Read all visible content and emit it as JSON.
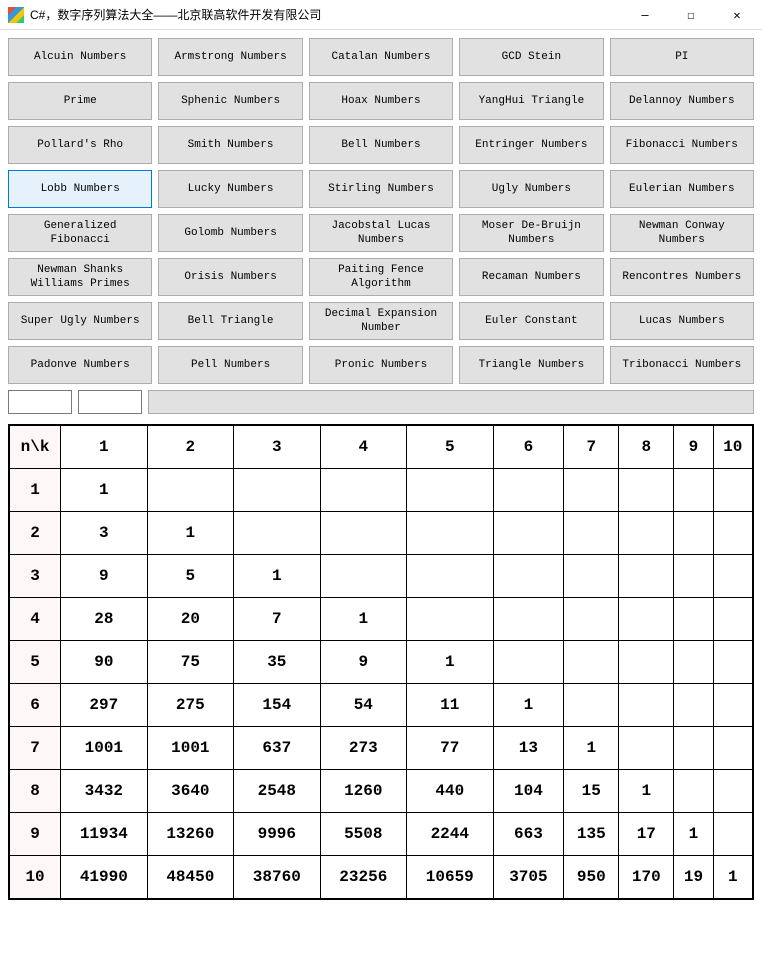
{
  "window": {
    "title": "C#，数字序列算法大全——北京联高软件开发有限公司",
    "min": "—",
    "max": "☐",
    "close": "✕"
  },
  "buttons": [
    [
      {
        "label": "Alcuin Numbers",
        "selected": false
      },
      {
        "label": "Armstrong Numbers",
        "selected": false
      },
      {
        "label": "Catalan Numbers",
        "selected": false
      },
      {
        "label": "GCD Stein",
        "selected": false
      },
      {
        "label": "PI",
        "selected": false
      }
    ],
    [
      {
        "label": "Prime",
        "selected": false
      },
      {
        "label": "Sphenic Numbers",
        "selected": false
      },
      {
        "label": "Hoax Numbers",
        "selected": false
      },
      {
        "label": "YangHui Triangle",
        "selected": false
      },
      {
        "label": "Delannoy Numbers",
        "selected": false
      }
    ],
    [
      {
        "label": "Pollard's Rho",
        "selected": false
      },
      {
        "label": "Smith Numbers",
        "selected": false
      },
      {
        "label": "Bell Numbers",
        "selected": false
      },
      {
        "label": "Entringer Numbers",
        "selected": false
      },
      {
        "label": "Fibonacci Numbers",
        "selected": false
      }
    ],
    [
      {
        "label": "Lobb Numbers",
        "selected": true
      },
      {
        "label": "Lucky Numbers",
        "selected": false
      },
      {
        "label": "Stirling Numbers",
        "selected": false
      },
      {
        "label": "Ugly Numbers",
        "selected": false
      },
      {
        "label": "Eulerian Numbers",
        "selected": false
      }
    ],
    [
      {
        "label": "Generalized Fibonacci",
        "selected": false
      },
      {
        "label": "Golomb Numbers",
        "selected": false
      },
      {
        "label": "Jacobstal Lucas Numbers",
        "selected": false
      },
      {
        "label": "Moser De-Bruijn Numbers",
        "selected": false
      },
      {
        "label": "Newman Conway Numbers",
        "selected": false
      }
    ],
    [
      {
        "label": "Newman Shanks Williams Primes",
        "selected": false
      },
      {
        "label": "Orisis Numbers",
        "selected": false
      },
      {
        "label": "Paiting Fence Algorithm",
        "selected": false
      },
      {
        "label": "Recaman Numbers",
        "selected": false
      },
      {
        "label": "Rencontres Numbers",
        "selected": false
      }
    ],
    [
      {
        "label": "Super Ugly Numbers",
        "selected": false
      },
      {
        "label": "Bell Triangle",
        "selected": false
      },
      {
        "label": "Decimal Expansion Number",
        "selected": false
      },
      {
        "label": "Euler Constant",
        "selected": false
      },
      {
        "label": "Lucas Numbers",
        "selected": false
      }
    ],
    [
      {
        "label": "Padonve Numbers",
        "selected": false
      },
      {
        "label": "Pell Numbers",
        "selected": false
      },
      {
        "label": "Pronic Numbers",
        "selected": false
      },
      {
        "label": "Triangle Numbers",
        "selected": false
      },
      {
        "label": "Tribonacci Numbers",
        "selected": false
      }
    ]
  ],
  "inputs": {
    "field1": "",
    "field2": ""
  },
  "table": {
    "corner": "n\\k",
    "cols": [
      "1",
      "2",
      "3",
      "4",
      "5",
      "6",
      "7",
      "8",
      "9",
      "10"
    ],
    "rows": [
      {
        "n": "1",
        "vals": [
          "1",
          "",
          "",
          "",
          "",
          "",
          "",
          "",
          "",
          ""
        ]
      },
      {
        "n": "2",
        "vals": [
          "3",
          "1",
          "",
          "",
          "",
          "",
          "",
          "",
          "",
          ""
        ]
      },
      {
        "n": "3",
        "vals": [
          "9",
          "5",
          "1",
          "",
          "",
          "",
          "",
          "",
          "",
          ""
        ]
      },
      {
        "n": "4",
        "vals": [
          "28",
          "20",
          "7",
          "1",
          "",
          "",
          "",
          "",
          "",
          ""
        ]
      },
      {
        "n": "5",
        "vals": [
          "90",
          "75",
          "35",
          "9",
          "1",
          "",
          "",
          "",
          "",
          ""
        ]
      },
      {
        "n": "6",
        "vals": [
          "297",
          "275",
          "154",
          "54",
          "11",
          "1",
          "",
          "",
          "",
          ""
        ]
      },
      {
        "n": "7",
        "vals": [
          "1001",
          "1001",
          "637",
          "273",
          "77",
          "13",
          "1",
          "",
          "",
          ""
        ]
      },
      {
        "n": "8",
        "vals": [
          "3432",
          "3640",
          "2548",
          "1260",
          "440",
          "104",
          "15",
          "1",
          "",
          ""
        ]
      },
      {
        "n": "9",
        "vals": [
          "11934",
          "13260",
          "9996",
          "5508",
          "2244",
          "663",
          "135",
          "17",
          "1",
          ""
        ]
      },
      {
        "n": "10",
        "vals": [
          "41990",
          "48450",
          "38760",
          "23256",
          "10659",
          "3705",
          "950",
          "170",
          "19",
          "1"
        ]
      }
    ]
  },
  "chart_data": {
    "type": "table",
    "title": "Lobb Numbers L(n,k)",
    "xlabel": "k",
    "ylabel": "n",
    "categories": [
      "1",
      "2",
      "3",
      "4",
      "5",
      "6",
      "7",
      "8",
      "9",
      "10"
    ],
    "series": [
      {
        "name": "n=1",
        "values": [
          1,
          null,
          null,
          null,
          null,
          null,
          null,
          null,
          null,
          null
        ]
      },
      {
        "name": "n=2",
        "values": [
          3,
          1,
          null,
          null,
          null,
          null,
          null,
          null,
          null,
          null
        ]
      },
      {
        "name": "n=3",
        "values": [
          9,
          5,
          1,
          null,
          null,
          null,
          null,
          null,
          null,
          null
        ]
      },
      {
        "name": "n=4",
        "values": [
          28,
          20,
          7,
          1,
          null,
          null,
          null,
          null,
          null,
          null
        ]
      },
      {
        "name": "n=5",
        "values": [
          90,
          75,
          35,
          9,
          1,
          null,
          null,
          null,
          null,
          null
        ]
      },
      {
        "name": "n=6",
        "values": [
          297,
          275,
          154,
          54,
          11,
          1,
          null,
          null,
          null,
          null
        ]
      },
      {
        "name": "n=7",
        "values": [
          1001,
          1001,
          637,
          273,
          77,
          13,
          1,
          null,
          null,
          null
        ]
      },
      {
        "name": "n=8",
        "values": [
          3432,
          3640,
          2548,
          1260,
          440,
          104,
          15,
          1,
          null,
          null
        ]
      },
      {
        "name": "n=9",
        "values": [
          11934,
          13260,
          9996,
          5508,
          2244,
          663,
          135,
          17,
          1,
          null
        ]
      },
      {
        "name": "n=10",
        "values": [
          41990,
          48450,
          38760,
          23256,
          10659,
          3705,
          950,
          170,
          19,
          1
        ]
      }
    ]
  }
}
